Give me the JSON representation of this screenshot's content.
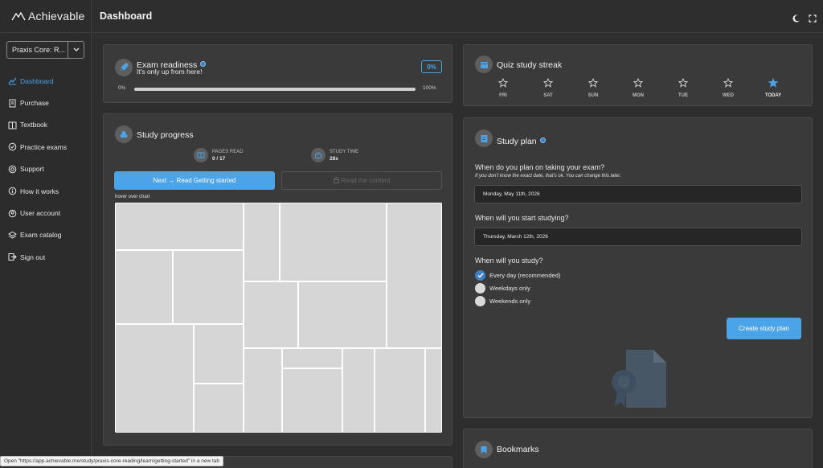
{
  "app": {
    "logo_text": "Achievable",
    "page_title": "Dashboard"
  },
  "course_select": {
    "value": "Praxis Core: R..."
  },
  "sidebar": {
    "items": [
      {
        "label": "Dashboard",
        "icon": "chart-icon",
        "active": true
      },
      {
        "label": "Purchase",
        "icon": "receipt-icon"
      },
      {
        "label": "Textbook",
        "icon": "book-icon"
      },
      {
        "label": "Practice exams",
        "icon": "exam-icon"
      },
      {
        "label": "Support",
        "icon": "lifebuoy-icon"
      },
      {
        "label": "How it works",
        "icon": "info-icon"
      },
      {
        "label": "User account",
        "icon": "user-icon"
      },
      {
        "label": "Exam catalog",
        "icon": "layers-icon"
      },
      {
        "label": "Sign out",
        "icon": "signout-icon"
      }
    ]
  },
  "exam_readiness": {
    "title": "Exam readiness",
    "subtitle": "It's only up from here!",
    "badge": "0%",
    "progress_min_label": "0%",
    "progress_max_label": "100%",
    "progress": 0
  },
  "study_progress": {
    "title": "Study progress",
    "pages_read_label": "PAGES READ",
    "pages_read_value": "0 / 17",
    "study_time_label": "STUDY TIME",
    "study_time_value": "28s",
    "next_button": "Next → Read Getting started",
    "read_button": "Read the content",
    "chart_hint": "hover over chart"
  },
  "quiz_streak": {
    "title": "Quiz study streak",
    "days": [
      {
        "label": "FRI",
        "filled": false
      },
      {
        "label": "SAT",
        "filled": false
      },
      {
        "label": "SUN",
        "filled": false
      },
      {
        "label": "MON",
        "filled": false
      },
      {
        "label": "TUE",
        "filled": false
      },
      {
        "label": "WED",
        "filled": false
      },
      {
        "label": "TODAY",
        "filled": true
      }
    ]
  },
  "study_plan": {
    "title": "Study plan",
    "q1": "When do you plan on taking your exam?",
    "q1_hint": "If you don't know the exact date, that's ok. You can change this later.",
    "exam_date": "Monday, May 11th, 2026",
    "q2": "When will you start studying?",
    "start_date": "Thursday, March 12th, 2026",
    "q3": "When will you study?",
    "options": [
      {
        "label": "Every day (recommended)",
        "checked": true
      },
      {
        "label": "Weekdays only",
        "checked": false
      },
      {
        "label": "Weekends only",
        "checked": false
      }
    ],
    "create_button": "Create study plan"
  },
  "bookmarks": {
    "title": "Bookmarks"
  },
  "status_tip": "Open \"https://app.achievable.me/study/praxis-core-reading/learn/getting-started\" in a new tab",
  "colors": {
    "accent": "#4ba3e8",
    "background": "#2e2e2e",
    "card": "#3a3a3a"
  }
}
